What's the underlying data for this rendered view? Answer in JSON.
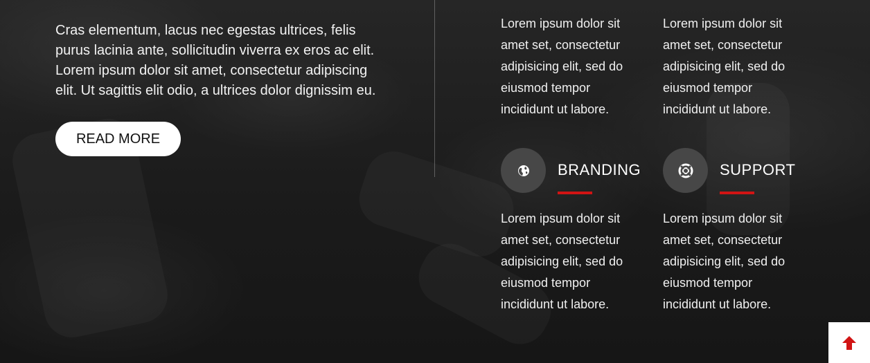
{
  "intro": {
    "text": "Cras elementum, lacus nec egestas ultrices, felis purus lacinia ante, sollicitudin viverra ex eros ac elit. Lorem ipsum dolor sit amet, consectetur adipiscing elit. Ut sagittis elit odio, a ultrices dolor dignissim eu.",
    "button_label": "READ MORE"
  },
  "features": {
    "top_left_text": "Lorem ipsum dolor sit amet set, consectetur adipisicing elit, sed do eiusmod tempor incididunt ut labore.",
    "top_right_text": "Lorem ipsum dolor sit amet set, consectetur adipisicing elit, sed do eiusmod tempor incididunt ut labore.",
    "branding": {
      "title": "BRANDING",
      "icon": "globe-icon",
      "text": "Lorem ipsum dolor sit amet set, consectetur adipisicing elit, sed do eiusmod tempor incididunt ut labore."
    },
    "support": {
      "title": "SUPPORT",
      "icon": "lifebuoy-icon",
      "text": "Lorem ipsum dolor sit amet set, consectetur adipisicing elit, sed do eiusmod tempor incididunt ut labore."
    }
  },
  "scroll_top": {
    "icon": "arrow-up-icon"
  },
  "colors": {
    "accent": "#d11414",
    "icon_bg": "#474747",
    "background": "#1a1a1a"
  }
}
